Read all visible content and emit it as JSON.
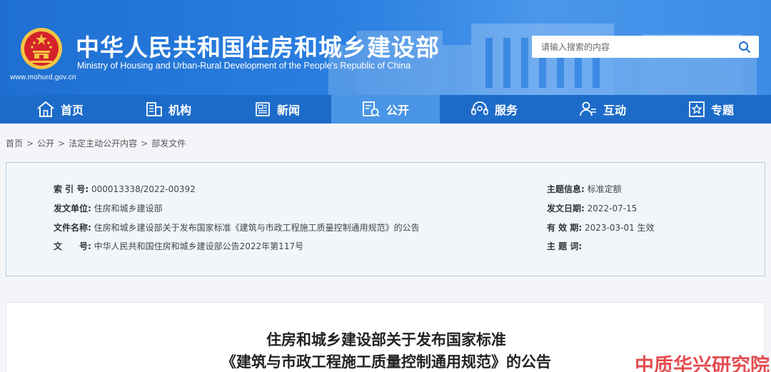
{
  "header": {
    "title_cn": "中华人民共和国住房和城乡建设部",
    "title_en": "Ministry of Housing and Urban-Rural Development of the People's Republic of China",
    "site_url": "www.mohurd.gov.cn",
    "search_placeholder": "请输入搜索的内容",
    "search_icon": "search-icon",
    "brand_color": "#1e6fd1"
  },
  "nav": {
    "active_color": "#4a95e6",
    "items": [
      {
        "label": "首页",
        "icon": "home-icon"
      },
      {
        "label": "机构",
        "icon": "building-icon"
      },
      {
        "label": "新闻",
        "icon": "newspaper-icon"
      },
      {
        "label": "公开",
        "icon": "document-icon",
        "active": true
      },
      {
        "label": "服务",
        "icon": "headset-icon"
      },
      {
        "label": "互动",
        "icon": "chat-user-icon"
      },
      {
        "label": "专题",
        "icon": "star-icon"
      }
    ]
  },
  "breadcrumb": [
    "首页",
    "公开",
    "法定主动公开内容",
    "部发文件"
  ],
  "info": {
    "index_label": "索 引 号:",
    "index_value": "000013338/2022-00392",
    "issuer_label": "发文单位:",
    "issuer_value": "住房和城乡建设部",
    "filename_label": "文件名称:",
    "filename_value": "住房和城乡建设部关于发布国家标准《建筑与市政工程施工质量控制通用规范》的公告",
    "docno_label": "文　　号:",
    "docno_value": "中华人民共和国住房和城乡建设部公告2022年第117号",
    "topic_label": "主题信息:",
    "topic_value": "标准定额",
    "date_label": "发文日期:",
    "date_value": "2022-07-15",
    "valid_label": "有 效 期:",
    "valid_value": "2023-03-01 生效",
    "keywords_label": "主 题 词:",
    "keywords_value": ""
  },
  "document": {
    "title_line1": "住房和城乡建设部关于发布国家标准",
    "title_line2": "《建筑与市政工程施工质量控制通用规范》的公告"
  },
  "watermark": "中质华兴研究院"
}
